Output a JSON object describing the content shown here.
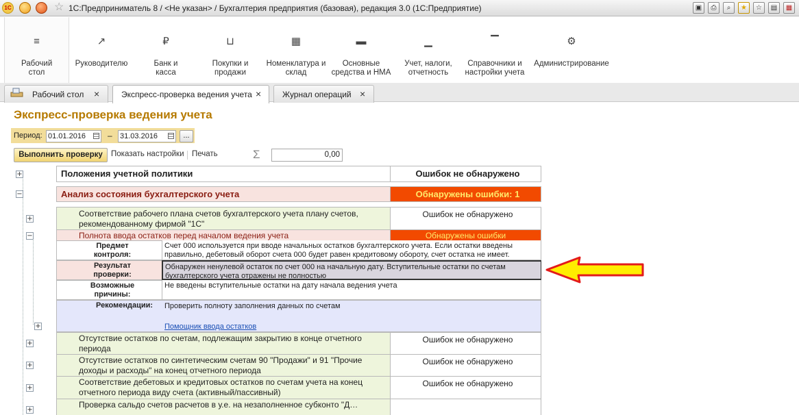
{
  "titlebar": {
    "logo_text": "1С",
    "title": "1С:Предприниматель 8 / <Не указан> / Бухгалтерия предприятия (базовая), редакция 3.0  (1С:Предприятие)",
    "icons": [
      "save-icon",
      "print-icon",
      "search-icon",
      "star-icon",
      "favorites-icon",
      "calculator-icon",
      "calendar-icon"
    ]
  },
  "sections": [
    {
      "label": "Рабочий стол",
      "icon": "≡"
    },
    {
      "label": "Руководителю",
      "icon": "↗"
    },
    {
      "label": "Банк и касса",
      "icon": "₽"
    },
    {
      "label": "Покупки и продажи",
      "icon": "🛒"
    },
    {
      "label": "Номенклатура и склад",
      "icon": "▦"
    },
    {
      "label": "Основные средства и НМА",
      "icon": "▬"
    },
    {
      "label": "Учет, налоги, отчетность",
      "icon": "▁"
    },
    {
      "label": "Справочники и настройки учета",
      "icon": "▔"
    },
    {
      "label": "Администрирование",
      "icon": "⚙"
    }
  ],
  "tabs": [
    {
      "label": "Рабочий стол"
    },
    {
      "label": "Экспресс-проверка ведения учета"
    },
    {
      "label": "Журнал операций"
    }
  ],
  "form": {
    "title": "Экспресс-проверка ведения учета",
    "period_label": "Период:",
    "date_from": "01.01.2016",
    "date_to": "31.03.2016",
    "dash": "–",
    "ellipsis": "...",
    "run_button": "Выполнить проверку",
    "show_settings": "Показать настройки",
    "print": "Печать",
    "sigma": "Σ",
    "total": "0,00"
  },
  "report": {
    "group1": {
      "title": "Положения учетной политики",
      "status": "Ошибок не обнаружено"
    },
    "group2": {
      "title": "Анализ состояния бухгалтерского учета",
      "status": "Обнаружены ошибки: 1"
    },
    "row1": {
      "title": "Соответствие рабочего плана счетов бухгалтерского учета плану счетов, рекомендованному фирмой \"1С\"",
      "status": "Ошибок не обнаружено"
    },
    "row2": {
      "title": "Полнота ввода остатков перед началом ведения учета",
      "status": "Обнаружены ошибки"
    },
    "detail": {
      "subject_label": "Предмет контроля:",
      "subject_text": "Счет 000 используется при вводе начальных остатков бухгалтерского учета. Если остатки введены правильно, дебетовый оборот счета 000 будет равен кредитовому обороту, счет остатка не имеет.",
      "result_label": "Результат проверки:",
      "result_text": "Обнаружен ненулевой остаток по счет 000 на начальную дату. Вступительные остатки по счетам бухгалтерского учета отражены не полностью",
      "reasons_label": "Возможные причины:",
      "reasons_text": "Не введены вступительные остатки на дату начала ведения учета",
      "recommend_label": "Рекомендации:",
      "recommend_text": "Проверить полноту заполнения данных по счетам",
      "recommend_link": "Помощник ввода остатков"
    },
    "row3": {
      "title": "Отсутствие остатков по счетам, подлежащим закрытию в конце отчетного периода",
      "status": "Ошибок не обнаружено"
    },
    "row4": {
      "title": "Отсутствие остатков по синтетическим счетам 90 \"Продажи\" и 91 \"Прочие доходы и расходы\" на конец отчетного периода",
      "status": "Ошибок не обнаружено"
    },
    "row5": {
      "title": "Соответствие дебетовых и кредитовых остатков по счетам учета на конец отчетного периода виду счета (активный/пассивный)",
      "status": "Ошибок не обнаружено"
    },
    "row6": {
      "title": "Проверка сальдо счетов расчетов в у.е. на незаполненное субконто \"Д…",
      "status": ""
    }
  },
  "annotation": {
    "arrow_fill": "#ffee00",
    "arrow_stroke": "#e31b1b"
  }
}
